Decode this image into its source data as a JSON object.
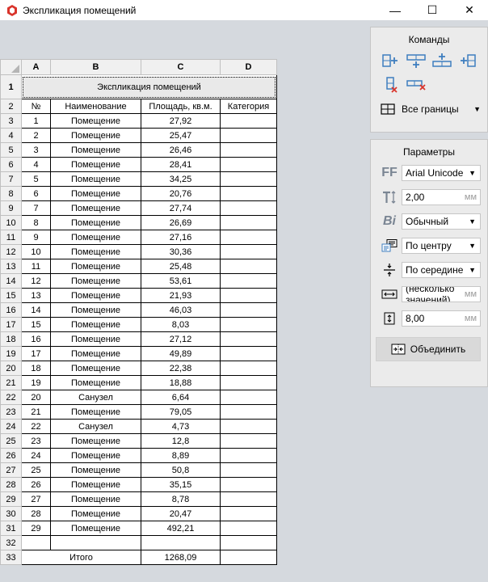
{
  "window": {
    "title": "Экспликация помещений",
    "minimize": "—",
    "maximize": "☐",
    "close": "✕"
  },
  "grid": {
    "columns": [
      "A",
      "B",
      "C",
      "D"
    ],
    "title_row": {
      "number": "1",
      "text": "Экспликация помещений"
    },
    "header_row": {
      "number": "2",
      "cells": [
        "№",
        "Наименование",
        "Площадь, кв.м.",
        "Категория"
      ]
    },
    "rows": [
      {
        "n": "3",
        "cells": [
          "1",
          "Помещение",
          "27,92",
          ""
        ]
      },
      {
        "n": "4",
        "cells": [
          "2",
          "Помещение",
          "25,47",
          ""
        ]
      },
      {
        "n": "5",
        "cells": [
          "3",
          "Помещение",
          "26,46",
          ""
        ]
      },
      {
        "n": "6",
        "cells": [
          "4",
          "Помещение",
          "28,41",
          ""
        ]
      },
      {
        "n": "7",
        "cells": [
          "5",
          "Помещение",
          "34,25",
          ""
        ]
      },
      {
        "n": "8",
        "cells": [
          "6",
          "Помещение",
          "20,76",
          ""
        ]
      },
      {
        "n": "9",
        "cells": [
          "7",
          "Помещение",
          "27,74",
          ""
        ]
      },
      {
        "n": "10",
        "cells": [
          "8",
          "Помещение",
          "26,69",
          ""
        ]
      },
      {
        "n": "11",
        "cells": [
          "9",
          "Помещение",
          "27,16",
          ""
        ]
      },
      {
        "n": "12",
        "cells": [
          "10",
          "Помещение",
          "30,36",
          ""
        ]
      },
      {
        "n": "13",
        "cells": [
          "11",
          "Помещение",
          "25,48",
          ""
        ]
      },
      {
        "n": "14",
        "cells": [
          "12",
          "Помещение",
          "53,61",
          ""
        ]
      },
      {
        "n": "15",
        "cells": [
          "13",
          "Помещение",
          "21,93",
          ""
        ]
      },
      {
        "n": "16",
        "cells": [
          "14",
          "Помещение",
          "46,03",
          ""
        ]
      },
      {
        "n": "17",
        "cells": [
          "15",
          "Помещение",
          "8,03",
          ""
        ]
      },
      {
        "n": "18",
        "cells": [
          "16",
          "Помещение",
          "27,12",
          ""
        ]
      },
      {
        "n": "19",
        "cells": [
          "17",
          "Помещение",
          "49,89",
          ""
        ]
      },
      {
        "n": "20",
        "cells": [
          "18",
          "Помещение",
          "22,38",
          ""
        ]
      },
      {
        "n": "21",
        "cells": [
          "19",
          "Помещение",
          "18,88",
          ""
        ]
      },
      {
        "n": "22",
        "cells": [
          "20",
          "Санузел",
          "6,64",
          ""
        ]
      },
      {
        "n": "23",
        "cells": [
          "21",
          "Помещение",
          "79,05",
          ""
        ]
      },
      {
        "n": "24",
        "cells": [
          "22",
          "Санузел",
          "4,73",
          ""
        ]
      },
      {
        "n": "25",
        "cells": [
          "23",
          "Помещение",
          "12,8",
          ""
        ]
      },
      {
        "n": "26",
        "cells": [
          "24",
          "Помещение",
          "8,89",
          ""
        ]
      },
      {
        "n": "27",
        "cells": [
          "25",
          "Помещение",
          "50,8",
          ""
        ]
      },
      {
        "n": "28",
        "cells": [
          "26",
          "Помещение",
          "35,15",
          ""
        ]
      },
      {
        "n": "29",
        "cells": [
          "27",
          "Помещение",
          "8,78",
          ""
        ]
      },
      {
        "n": "30",
        "cells": [
          "28",
          "Помещение",
          "20,47",
          ""
        ]
      },
      {
        "n": "31",
        "cells": [
          "29",
          "Помещение",
          "492,21",
          ""
        ]
      },
      {
        "n": "32",
        "cells": [
          "",
          "",
          "",
          ""
        ]
      }
    ],
    "total_row": {
      "number": "33",
      "label": "Итого",
      "value": "1268,09",
      "extra": ""
    }
  },
  "commands": {
    "title": "Команды",
    "icons": [
      "insert-column-right-icon",
      "insert-row-below-icon",
      "insert-row-above-icon",
      "insert-column-left-icon",
      "delete-column-icon",
      "delete-row-icon"
    ],
    "borders_label": "Все границы",
    "borders_arrow": "▼"
  },
  "params": {
    "title": "Параметры",
    "font_icon": "FF",
    "font": "Arial Unicode",
    "size_icon": "T",
    "height": "2,00",
    "height_unit": "мм",
    "style_icon": "Bi",
    "style": "Обычный",
    "halign": "По центру",
    "valign": "По середине",
    "width": "(несколько значений)",
    "width_unit": "мм",
    "rowheight": "8,00",
    "rowheight_unit": "мм",
    "arrow": "▼",
    "merge_label": "Объединить"
  },
  "colors": {
    "accent_icon": "#3e7ebf",
    "delete_red": "#d9342b",
    "panel_bg": "#ebebeb",
    "workspace_bg": "#d5d9de"
  }
}
